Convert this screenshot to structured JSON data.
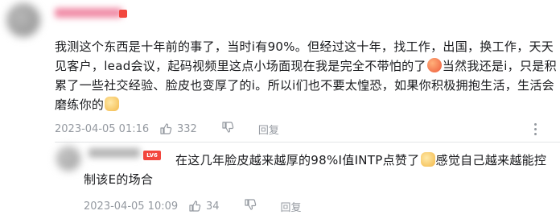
{
  "comment": {
    "level_badge": "",
    "text_part1": "我测这个东西是十年前的事了，当时i有90%。但经过这十年，找工作，出国，换工作，天天见客户，lead会议，起码视频里这点小场面现在我是完全不带怕的了",
    "text_part2": "当然我还是i，只是积累了一些社交经验、脸皮也变厚了的i。所以i们也不要太惶恐，如果你积极拥抱生活，生活会磨练你的",
    "emoji_1": "laughing-emoji",
    "emoji_2": "dog-emoji",
    "date": "2023-04-05 01:16",
    "like_count": "332",
    "reply_label": "回复"
  },
  "reply": {
    "level_badge": "LV6",
    "text_part1": "在这几年脸皮越来越厚的98%I值INTP点赞了",
    "text_part2": "感觉自己越来越能控制该E的场合",
    "emoji_1": "dog-emoji",
    "date": "2023-04-05 10:09",
    "like_count": "34",
    "reply_label": "回复"
  },
  "colors": {
    "text": "#18191c",
    "meta": "#9499a0",
    "level_badge": "#f2463d"
  }
}
